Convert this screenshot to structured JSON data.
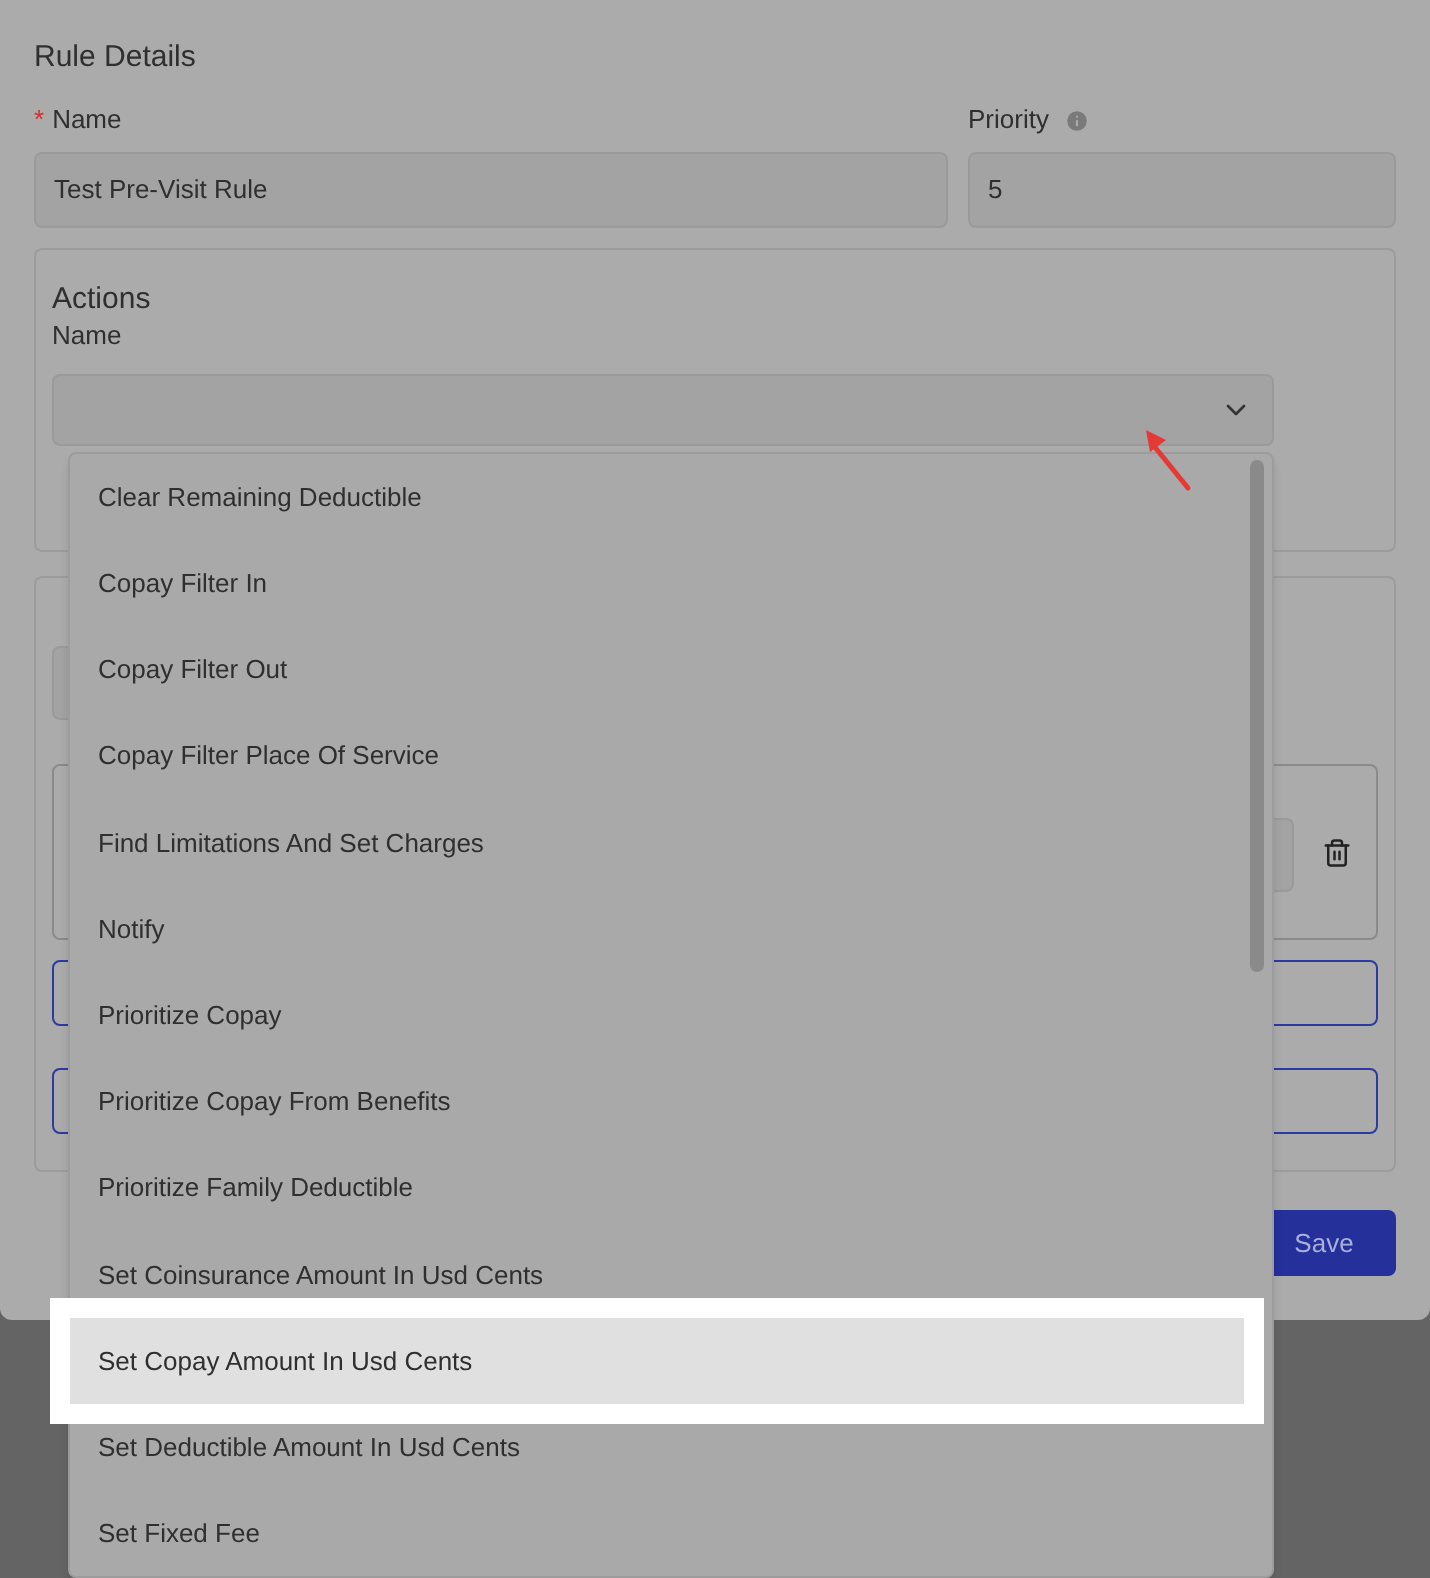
{
  "section_title": "Rule Details",
  "name_field": {
    "required_mark": "*",
    "label": "Name",
    "value": "Test Pre-Visit Rule"
  },
  "priority_field": {
    "label": "Priority",
    "value": "5"
  },
  "actions": {
    "title": "Actions",
    "name_label": "Name",
    "dropdown": {
      "expanded": true,
      "options": [
        {
          "label": "Clear Remaining Deductible",
          "selected": false
        },
        {
          "label": "Copay Filter In",
          "selected": false
        },
        {
          "label": "Copay Filter Out",
          "selected": false
        },
        {
          "label": "Copay Filter Place Of Service",
          "selected": false
        },
        {
          "label": "Find Limitations And Set Charges",
          "selected": false
        },
        {
          "label": "Notify",
          "selected": false
        },
        {
          "label": "Prioritize Copay",
          "selected": false
        },
        {
          "label": "Prioritize Copay From Benefits",
          "selected": false
        },
        {
          "label": "Prioritize Family Deductible",
          "selected": false
        },
        {
          "label": "Set Coinsurance Amount In Usd Cents",
          "selected": false
        },
        {
          "label": "Set Copay Amount In Usd Cents",
          "selected": true
        },
        {
          "label": "Set Deductible Amount In Usd Cents",
          "selected": false
        },
        {
          "label": "Set Fixed Fee",
          "selected": false
        }
      ]
    }
  },
  "save_button": "Save"
}
